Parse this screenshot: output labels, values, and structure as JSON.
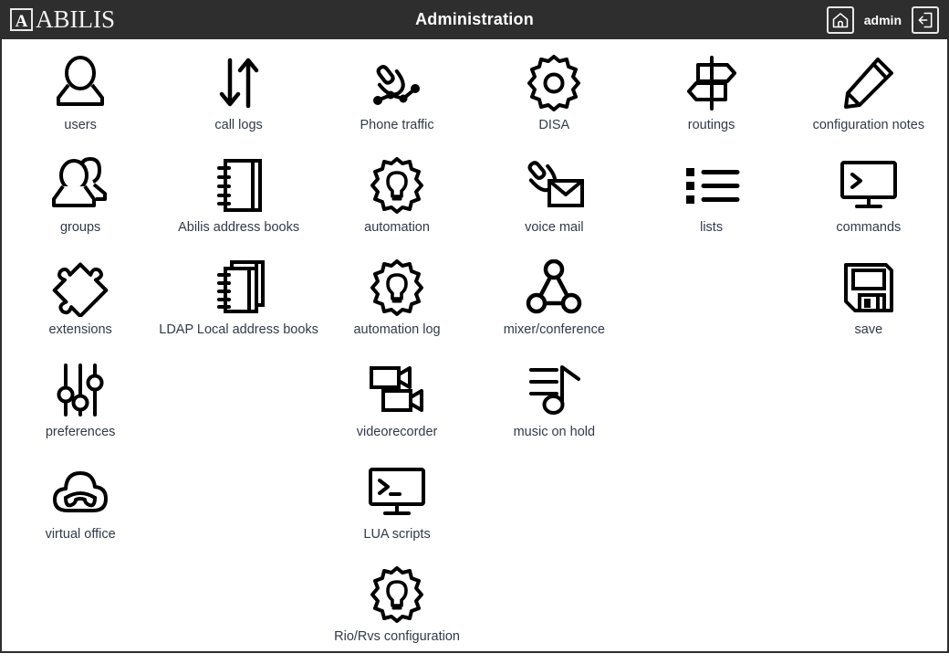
{
  "header": {
    "logo_mark": "A",
    "logo_text": "ABILIS",
    "title": "Administration",
    "home_icon": "home-icon",
    "user": "admin",
    "logout_icon": "logout-icon"
  },
  "colors": {
    "topbar_bg": "#2e2e2e",
    "page_bg": "#ffffff",
    "label_text": "#313a4a",
    "icon_stroke": "#000000",
    "border": "#2e2e2e"
  },
  "grid": {
    "columns": 6,
    "tiles": [
      {
        "label": "users",
        "icon": "user-icon",
        "row": 1,
        "col": 1
      },
      {
        "label": "call logs",
        "icon": "up-down-arrows-icon",
        "row": 1,
        "col": 2
      },
      {
        "label": "Phone traffic",
        "icon": "phone-network-icon",
        "row": 1,
        "col": 3
      },
      {
        "label": "DISA",
        "icon": "gear-icon",
        "row": 1,
        "col": 4
      },
      {
        "label": "routings",
        "icon": "signpost-icon",
        "row": 1,
        "col": 5
      },
      {
        "label": "configuration notes",
        "icon": "pencil-icon",
        "row": 1,
        "col": 6
      },
      {
        "label": "groups",
        "icon": "users-group-icon",
        "row": 2,
        "col": 1
      },
      {
        "label": "Abilis address books",
        "icon": "notebook-icon",
        "row": 2,
        "col": 2
      },
      {
        "label": "automation",
        "icon": "gear-bulb-icon",
        "row": 2,
        "col": 3
      },
      {
        "label": "voice mail",
        "icon": "handset-envelope-icon",
        "row": 2,
        "col": 4
      },
      {
        "label": "lists",
        "icon": "bullet-list-icon",
        "row": 2,
        "col": 5
      },
      {
        "label": "commands",
        "icon": "monitor-prompt-icon",
        "row": 2,
        "col": 6
      },
      {
        "label": "extensions",
        "icon": "puzzle-piece-icon",
        "row": 3,
        "col": 1
      },
      {
        "label": "LDAP Local address books",
        "icon": "notebook-stack-icon",
        "row": 3,
        "col": 2
      },
      {
        "label": "automation log",
        "icon": "gear-bulb-icon",
        "row": 3,
        "col": 3
      },
      {
        "label": "mixer/conference",
        "icon": "conference-nodes-icon",
        "row": 3,
        "col": 4
      },
      {
        "label": "",
        "icon": "",
        "row": 3,
        "col": 5
      },
      {
        "label": "save",
        "icon": "floppy-disk-icon",
        "row": 3,
        "col": 6
      },
      {
        "label": "preferences",
        "icon": "sliders-icon",
        "row": 4,
        "col": 1
      },
      {
        "label": "",
        "icon": "",
        "row": 4,
        "col": 2
      },
      {
        "label": "videorecorder",
        "icon": "video-camera-icon",
        "row": 4,
        "col": 3
      },
      {
        "label": "music on hold",
        "icon": "music-note-icon",
        "row": 4,
        "col": 4
      },
      {
        "label": "",
        "icon": "",
        "row": 4,
        "col": 5
      },
      {
        "label": "",
        "icon": "",
        "row": 4,
        "col": 6
      },
      {
        "label": "virtual office",
        "icon": "cloud-phone-icon",
        "row": 5,
        "col": 1
      },
      {
        "label": "",
        "icon": "",
        "row": 5,
        "col": 2
      },
      {
        "label": "LUA scripts",
        "icon": "monitor-prompt-icon",
        "row": 5,
        "col": 3
      },
      {
        "label": "",
        "icon": "",
        "row": 5,
        "col": 4
      },
      {
        "label": "",
        "icon": "",
        "row": 5,
        "col": 5
      },
      {
        "label": "",
        "icon": "",
        "row": 5,
        "col": 6
      },
      {
        "label": "",
        "icon": "",
        "row": 6,
        "col": 1
      },
      {
        "label": "",
        "icon": "",
        "row": 6,
        "col": 2
      },
      {
        "label": "Rio/Rvs configuration",
        "icon": "gear-bulb-icon",
        "row": 6,
        "col": 3
      },
      {
        "label": "",
        "icon": "",
        "row": 6,
        "col": 4
      },
      {
        "label": "",
        "icon": "",
        "row": 6,
        "col": 5
      },
      {
        "label": "",
        "icon": "",
        "row": 6,
        "col": 6
      }
    ]
  }
}
